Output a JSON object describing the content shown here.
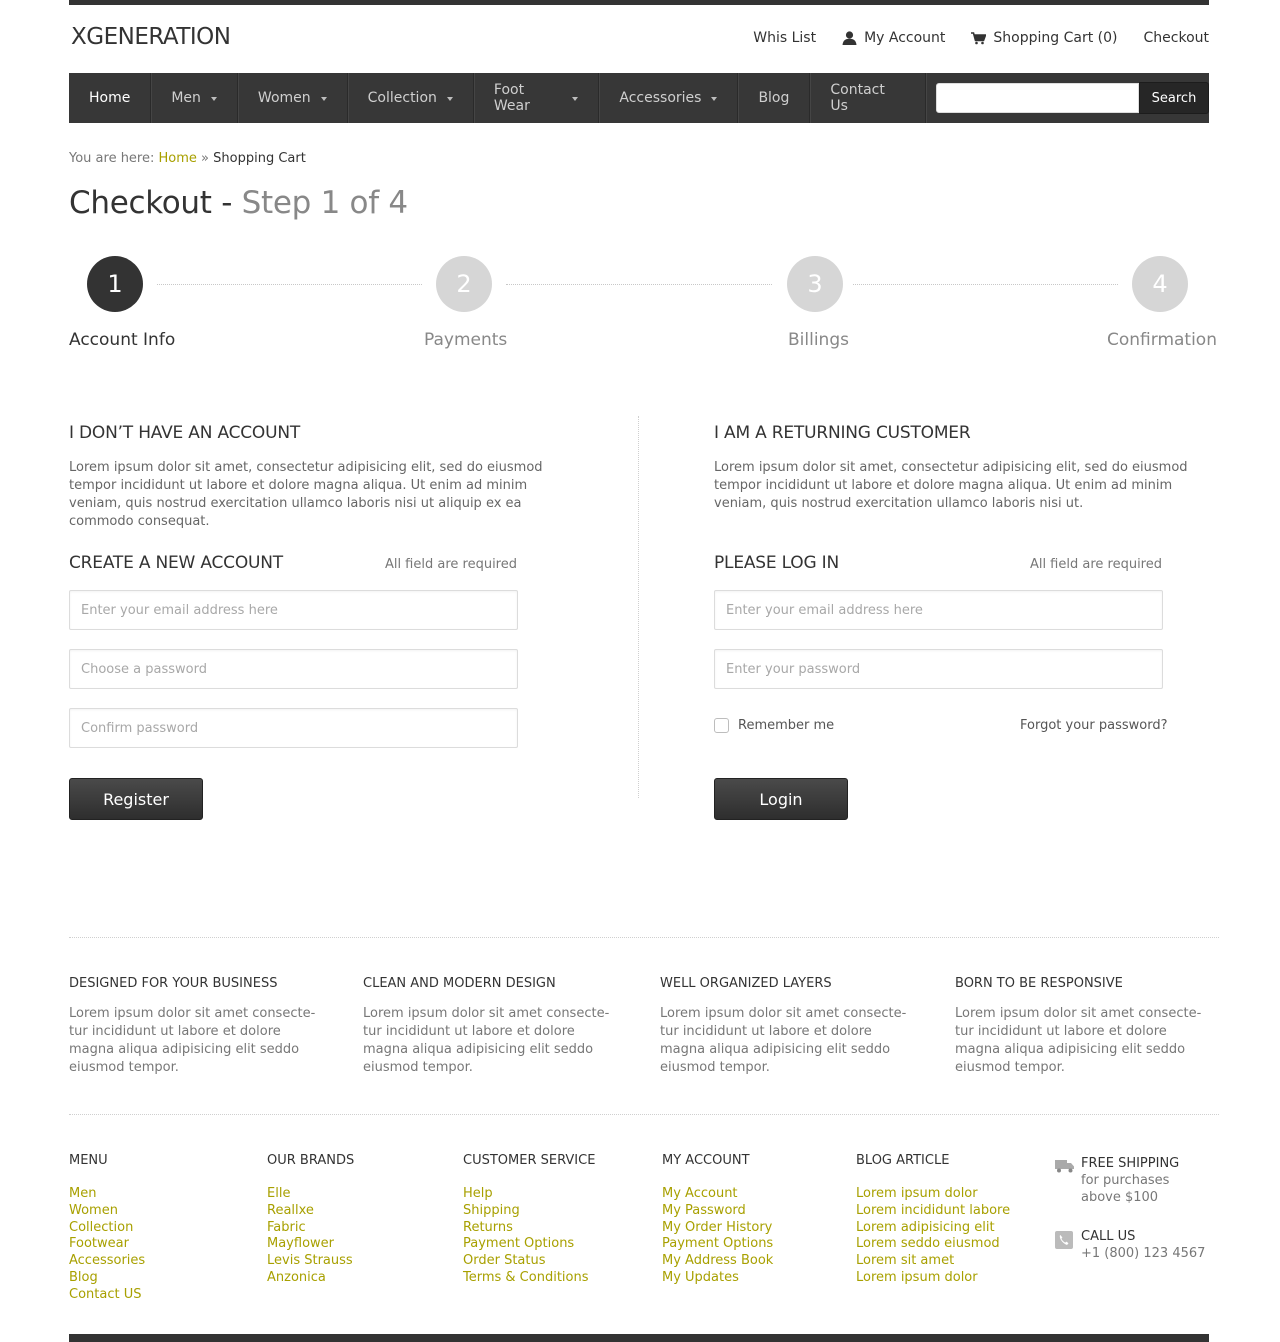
{
  "header": {
    "logo": "XGENERATION",
    "links": {
      "wishlist": "Whis List",
      "account": "My Account",
      "cart": "Shopping Cart (0)",
      "checkout": "Checkout"
    }
  },
  "nav": {
    "items": [
      {
        "label": "Home",
        "dropdown": false,
        "active": true
      },
      {
        "label": "Men",
        "dropdown": true
      },
      {
        "label": "Women",
        "dropdown": true
      },
      {
        "label": "Collection",
        "dropdown": true
      },
      {
        "label": "Foot Wear",
        "dropdown": true
      },
      {
        "label": "Accessories",
        "dropdown": true
      },
      {
        "label": "Blog",
        "dropdown": false
      },
      {
        "label": "Contact Us",
        "dropdown": false
      }
    ],
    "search_value": "",
    "search_button": "Search"
  },
  "breadcrumb": {
    "prefix": "You are here:",
    "home": "Home",
    "separator": "»",
    "current": "Shopping Cart"
  },
  "title": {
    "main": "Checkout",
    "dash": "-",
    "step": "Step 1 of 4"
  },
  "steps": [
    {
      "number": "1",
      "label": "Account Info",
      "active": true
    },
    {
      "number": "2",
      "label": "Payments",
      "active": false
    },
    {
      "number": "3",
      "label": "Billings",
      "active": false
    },
    {
      "number": "4",
      "label": "Confirmation",
      "active": false
    }
  ],
  "new_account": {
    "heading": "I DON’T HAVE AN ACCOUNT",
    "description": "Lorem ipsum dolor sit amet, consectetur adipisicing elit, sed do eiusmod tempor incididunt ut labore et dolore magna aliqua. Ut enim ad minim veniam, quis nostrud exercitation ullamco laboris nisi ut aliquip ex ea commodo consequat.",
    "form_title": "CREATE A NEW ACCOUNT",
    "required_note": "All field are required",
    "email_placeholder": "Enter your email address here",
    "password_placeholder": "Choose a password",
    "confirm_placeholder": "Confirm password",
    "button": "Register"
  },
  "returning": {
    "heading": "I AM A RETURNING CUSTOMER",
    "description": "Lorem ipsum dolor sit amet, consectetur adipisicing elit, sed do eiusmod tempor incididunt ut labore et dolore magna aliqua. Ut enim ad minim veniam, quis nostrud exercitation ullamco laboris nisi ut.",
    "form_title": "PLEASE LOG IN",
    "required_note": "All field are required",
    "email_placeholder": "Enter your email address here",
    "password_placeholder": "Enter your password",
    "remember_label": "Remember me",
    "remember_checked": false,
    "forgot_link": "Forgot your password?",
    "button": "Login"
  },
  "features": [
    {
      "title": "DESIGNED FOR YOUR BUSINESS",
      "text": "Lorem ipsum dolor sit amet consecte-tur incididunt ut labore et dolore magna aliqua adipisicing elit seddo eiusmod tempor."
    },
    {
      "title": "CLEAN AND MODERN DESIGN",
      "text": "Lorem ipsum dolor sit amet consecte-tur incididunt ut labore et dolore magna aliqua adipisicing elit seddo eiusmod tempor."
    },
    {
      "title": "WELL ORGANIZED LAYERS",
      "text": "Lorem ipsum dolor sit amet consecte-tur incididunt ut labore et dolore magna aliqua adipisicing elit seddo eiusmod tempor."
    },
    {
      "title": "BORN TO BE RESPONSIVE",
      "text": "Lorem ipsum dolor sit amet consecte-tur incididunt ut labore et dolore magna aliqua adipisicing elit seddo eiusmod tempor."
    }
  ],
  "footer": {
    "columns": [
      {
        "title": "MENU",
        "links": [
          "Men",
          "Women",
          "Collection",
          "Footwear",
          "Accessories",
          "Blog",
          "Contact US"
        ]
      },
      {
        "title": "OUR BRANDS",
        "links": [
          "Elle",
          "Reallxe",
          "Fabric",
          "Mayflower",
          "Levis Strauss",
          "Anzonica"
        ]
      },
      {
        "title": "CUSTOMER SERVICE",
        "links": [
          "Help",
          "Shipping",
          "Returns",
          "Payment Options",
          "Order Status",
          "Terms & Conditions"
        ]
      },
      {
        "title": "MY ACCOUNT",
        "links": [
          "My Account",
          "My Password",
          "My Order History",
          "Payment Options",
          "My Address Book",
          "My Updates"
        ]
      },
      {
        "title": "BLOG ARTICLE",
        "links": [
          "Lorem ipsum dolor",
          "Lorem incididunt labore",
          "Lorem adipisicing elit",
          "Lorem seddo eiusmod",
          "Lorem sit amet",
          "Lorem ipsum dolor"
        ]
      }
    ],
    "shipping": {
      "title": "FREE SHIPPING",
      "line1": "for purchases",
      "line2": "above $100"
    },
    "call": {
      "title": "CALL US",
      "phone": "+1 (800) 123 4567"
    }
  },
  "colors": {
    "accent": "#a8a000",
    "dark": "#333333",
    "nav_bg": "#373737"
  },
  "icons": {
    "account": "user-icon",
    "cart": "cart-icon",
    "shipping": "truck-icon",
    "call": "phone-icon"
  }
}
